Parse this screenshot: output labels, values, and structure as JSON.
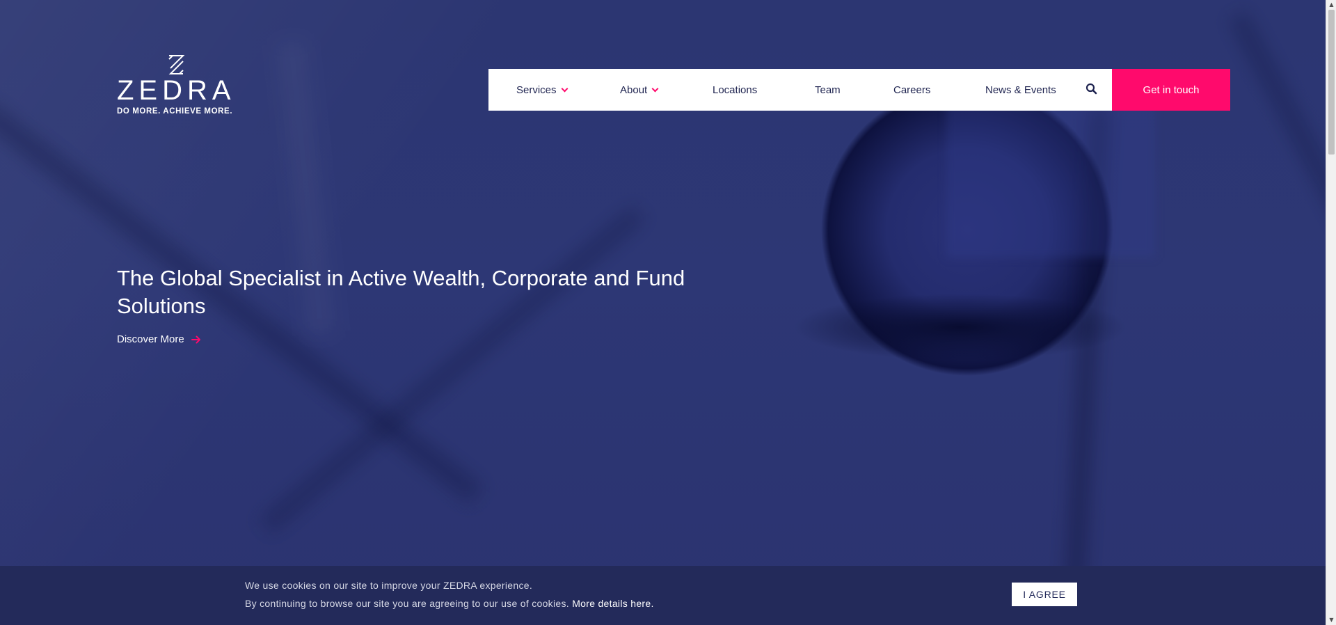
{
  "brand": {
    "name": "ZEDRA",
    "tagline": "DO MORE. ACHIEVE MORE.",
    "accent_color": "#ff0a6c",
    "navy_color": "#2d3670"
  },
  "nav": {
    "items": [
      {
        "label": "Services",
        "has_dropdown": true
      },
      {
        "label": "About",
        "has_dropdown": true
      },
      {
        "label": "Locations",
        "has_dropdown": false
      },
      {
        "label": "Team",
        "has_dropdown": false
      },
      {
        "label": "Careers",
        "has_dropdown": false
      },
      {
        "label": "News & Events",
        "has_dropdown": false
      }
    ],
    "search_icon": "search-icon",
    "cta_label": "Get in touch"
  },
  "hero": {
    "headline": "The Global Specialist in Active Wealth, Corporate and Fund Solutions",
    "link_label": "Discover More",
    "link_icon": "arrow-right-icon"
  },
  "cookie_banner": {
    "line1": "We use cookies on our site to improve your ZEDRA experience.",
    "line2": "By continuing to browse our site you are agreeing to our use of cookies.",
    "link_label": "More details here.",
    "button_label": "I AGREE"
  }
}
